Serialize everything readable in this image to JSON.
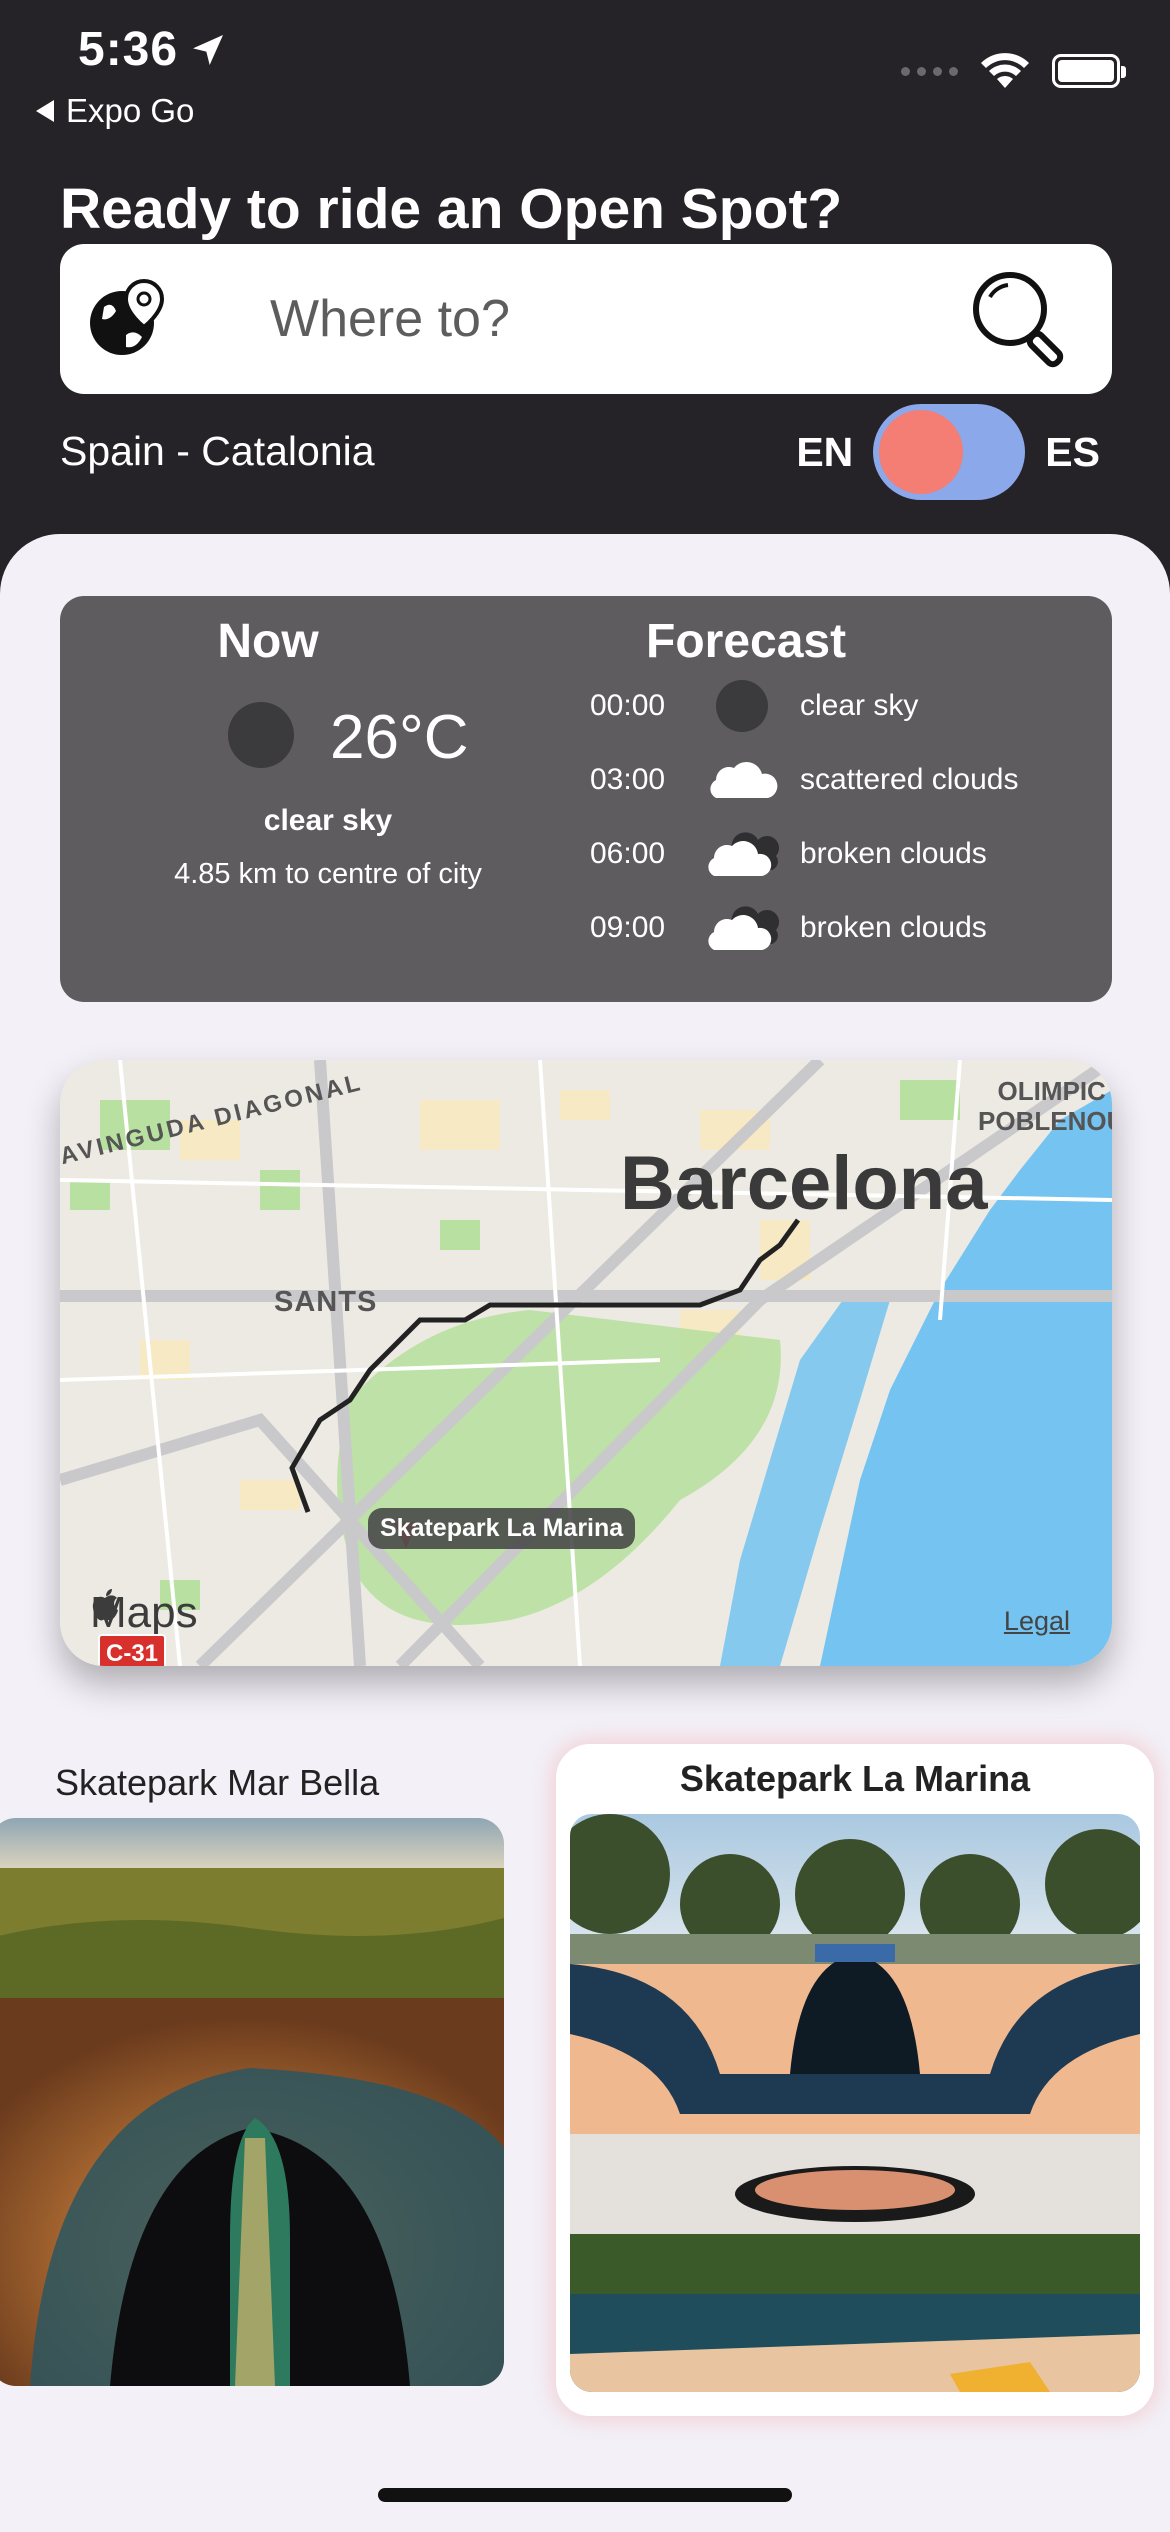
{
  "status_bar": {
    "time": "5:36",
    "back_label": "Expo Go"
  },
  "header": {
    "headline": "Ready to ride an Open Spot?",
    "search_placeholder": "Where to?",
    "region": "Spain - Catalonia",
    "lang_left": "EN",
    "lang_right": "ES"
  },
  "weather": {
    "now_title": "Now",
    "now_temp": "26°C",
    "now_desc": "clear sky",
    "now_distance": "4.85 km to centre of city",
    "forecast_title": "Forecast",
    "forecast": [
      {
        "time": "00:00",
        "icon": "moon-icon",
        "desc": "clear sky"
      },
      {
        "time": "03:00",
        "icon": "cloud-icon",
        "desc": "scattered clouds"
      },
      {
        "time": "06:00",
        "icon": "broken-clouds-icon",
        "desc": "broken clouds"
      },
      {
        "time": "09:00",
        "icon": "broken-clouds-icon",
        "desc": "broken clouds"
      }
    ]
  },
  "map": {
    "city": "Barcelona",
    "district_sants": "SANTS",
    "avenue": "AVINGUDA DIAGONAL",
    "poblenou_line1": "OLIMPIC",
    "poblenou_line2": "POBLENOU",
    "pin_label": "Skatepark La Marina",
    "logo_text": "Maps",
    "legal": "Legal",
    "road_sign": "C-31"
  },
  "spots": [
    {
      "name": "Skatepark Mar Bella"
    },
    {
      "name": "Skatepark La Marina"
    }
  ],
  "colors": {
    "header_bg": "#252328",
    "sheet_bg": "#f3f0f7",
    "weather_card": "#5e5c5e",
    "toggle_track": "#8aa8ea",
    "toggle_knob": "#f47d74",
    "water": "#74c3f0",
    "park": "#b8e0a0"
  }
}
